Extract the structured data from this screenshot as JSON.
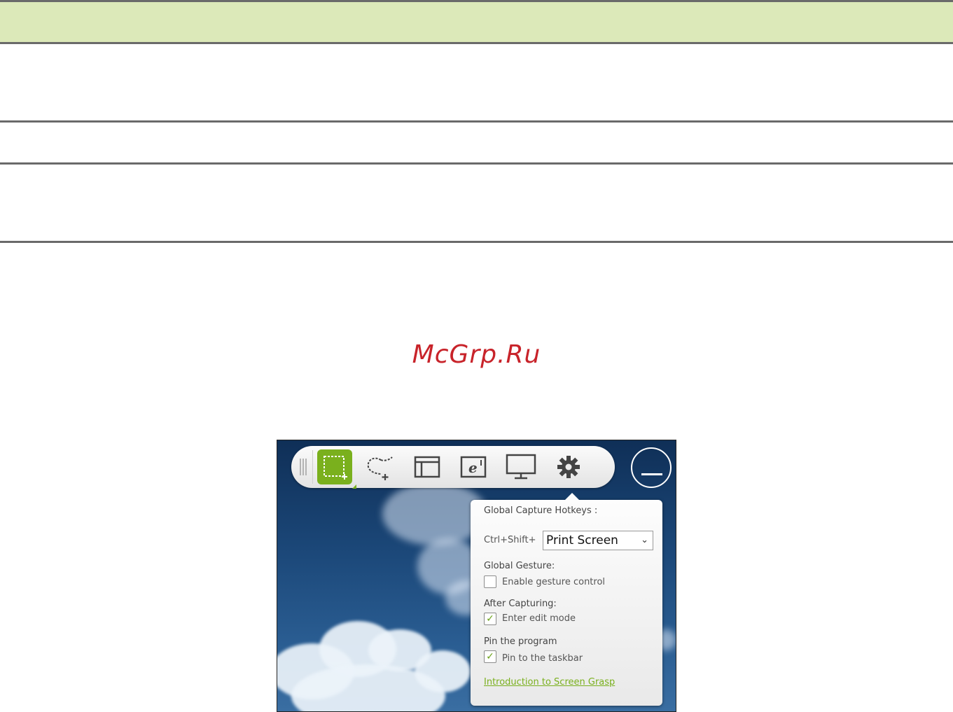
{
  "colors": {
    "band": "#dce9b9",
    "watermark": "#c8232a",
    "accent": "#7ab01d"
  },
  "watermark": "McGrp.Ru",
  "toolbar": {
    "tools": [
      {
        "name": "rectangle-capture",
        "icon": "rectangle-selection-plus-icon",
        "active": true
      },
      {
        "name": "freehand-capture",
        "icon": "freehand-selection-plus-icon",
        "active": false
      },
      {
        "name": "window-capture",
        "icon": "window-icon",
        "active": false
      },
      {
        "name": "webpage-capture",
        "icon": "browser-e-icon",
        "active": false
      },
      {
        "name": "fullscreen-capture",
        "icon": "monitor-icon",
        "active": false
      },
      {
        "name": "settings",
        "icon": "gear-icon",
        "active": false
      }
    ],
    "minimize_icon": "minimize-icon"
  },
  "settings": {
    "hotkeys_heading": "Global Capture Hotkeys :",
    "hotkey_prefix": "Ctrl+Shift+",
    "hotkey_value": "Print Screen",
    "gesture_heading": "Global Gesture:",
    "gesture_label": "Enable gesture control",
    "gesture_checked": false,
    "after_heading": "After Capturing:",
    "edit_label": "Enter edit mode",
    "edit_checked": true,
    "pin_heading": "Pin the program",
    "pin_label": "Pin to the taskbar",
    "pin_checked": true,
    "intro_link": "Introduction to Screen Grasp"
  }
}
